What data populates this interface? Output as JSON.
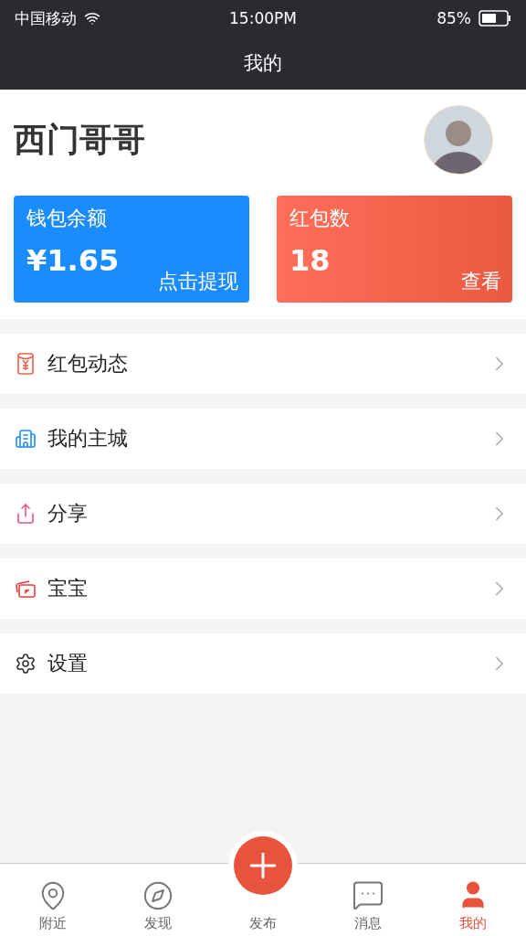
{
  "status_bar": {
    "carrier": "中国移动",
    "time": "15:00PM",
    "battery": "85%"
  },
  "header": {
    "title": "我的"
  },
  "profile": {
    "name": "西门哥哥"
  },
  "cards": [
    {
      "kind": "wallet",
      "label": "钱包余额",
      "value": "¥1.65",
      "action": "点击提现"
    },
    {
      "kind": "redpacket",
      "label": "红包数",
      "value": "18",
      "action": "查看"
    }
  ],
  "menu": [
    {
      "kind": "redpacket",
      "label": "红包动态"
    },
    {
      "kind": "city",
      "label": "我的主城"
    },
    {
      "kind": "share",
      "label": "分享"
    },
    {
      "kind": "baby",
      "label": "宝宝"
    },
    {
      "kind": "settings",
      "label": "设置"
    }
  ],
  "tab_bar": [
    {
      "kind": "location",
      "label": "附近",
      "selected": false
    },
    {
      "kind": "discover",
      "label": "发现",
      "selected": false
    },
    {
      "kind": "publish",
      "label": "发布",
      "selected": false
    },
    {
      "kind": "message",
      "label": "消息",
      "selected": false
    },
    {
      "kind": "me",
      "label": "我的",
      "selected": true
    }
  ]
}
